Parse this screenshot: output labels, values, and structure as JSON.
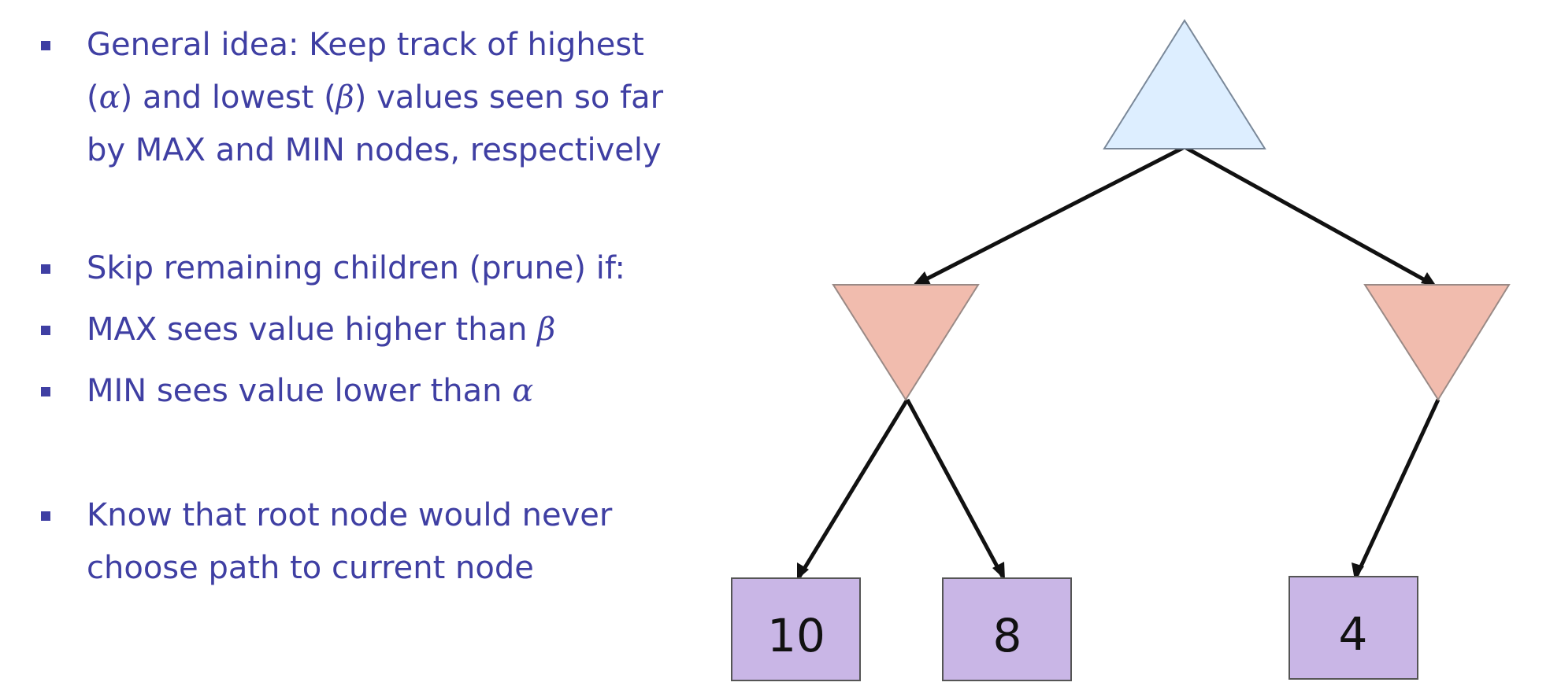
{
  "bullets": [
    {
      "lines": [
        {
          "parts": [
            {
              "t": "General idea: Keep track of highest"
            }
          ]
        },
        {
          "parts": [
            {
              "t": "("
            },
            {
              "t": "α",
              "greek": true
            },
            {
              "t": ") and lowest ("
            },
            {
              "t": "β",
              "greek": true
            },
            {
              "t": ") values seen so far"
            }
          ]
        },
        {
          "parts": [
            {
              "t": "by MAX and MIN nodes, respectively"
            }
          ]
        }
      ]
    },
    {
      "lines": [
        {
          "parts": [
            {
              "t": "Skip remaining children (prune) if:"
            }
          ]
        }
      ]
    },
    {
      "lines": [
        {
          "parts": [
            {
              "t": "MAX sees value higher than "
            },
            {
              "t": "β",
              "greek": true
            }
          ]
        }
      ]
    },
    {
      "lines": [
        {
          "parts": [
            {
              "t": "MIN sees value lower than "
            },
            {
              "t": "α",
              "greek": true
            }
          ]
        }
      ]
    },
    {
      "lines": [
        {
          "parts": [
            {
              "t": "Know that root node would never"
            }
          ]
        },
        {
          "parts": [
            {
              "t": "choose path to current node"
            }
          ]
        }
      ]
    }
  ],
  "tree": {
    "root": {
      "type": "MAX"
    },
    "children": [
      {
        "type": "MIN",
        "leaves": [
          "10",
          "8"
        ]
      },
      {
        "type": "MIN",
        "leaves": [
          "4"
        ]
      }
    ]
  },
  "colors": {
    "text": "#3f3fa3",
    "max_node_fill": "#ddeeff",
    "min_node_fill": "#f1bcae",
    "leaf_fill": "#c9b6e6",
    "edge": "#111111"
  }
}
